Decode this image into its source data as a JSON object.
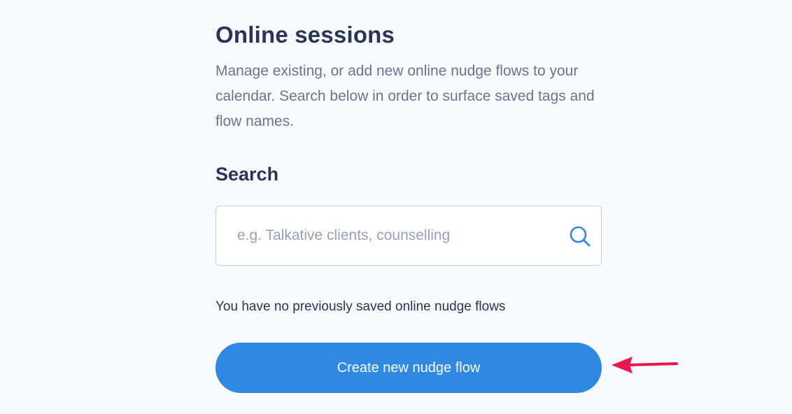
{
  "header": {
    "title": "Online sessions",
    "description": "Manage existing, or add new online nudge flows to your calendar. Search below in order to surface saved tags and flow names."
  },
  "search": {
    "heading": "Search",
    "placeholder": "e.g. Talkative clients, counselling",
    "value": "",
    "icon": "search-icon"
  },
  "flows": {
    "empty_message": "You have no previously saved online nudge flows"
  },
  "actions": {
    "create_label": "Create new nudge flow"
  },
  "annotation": {
    "icon": "arrow-left-icon"
  },
  "colors": {
    "background": "#f7fbfe",
    "heading": "#2a3458",
    "body_text": "#6b7394",
    "accent_button": "#2f89e3",
    "search_icon": "#2f89e3",
    "annotation_arrow": "#e8184f"
  }
}
